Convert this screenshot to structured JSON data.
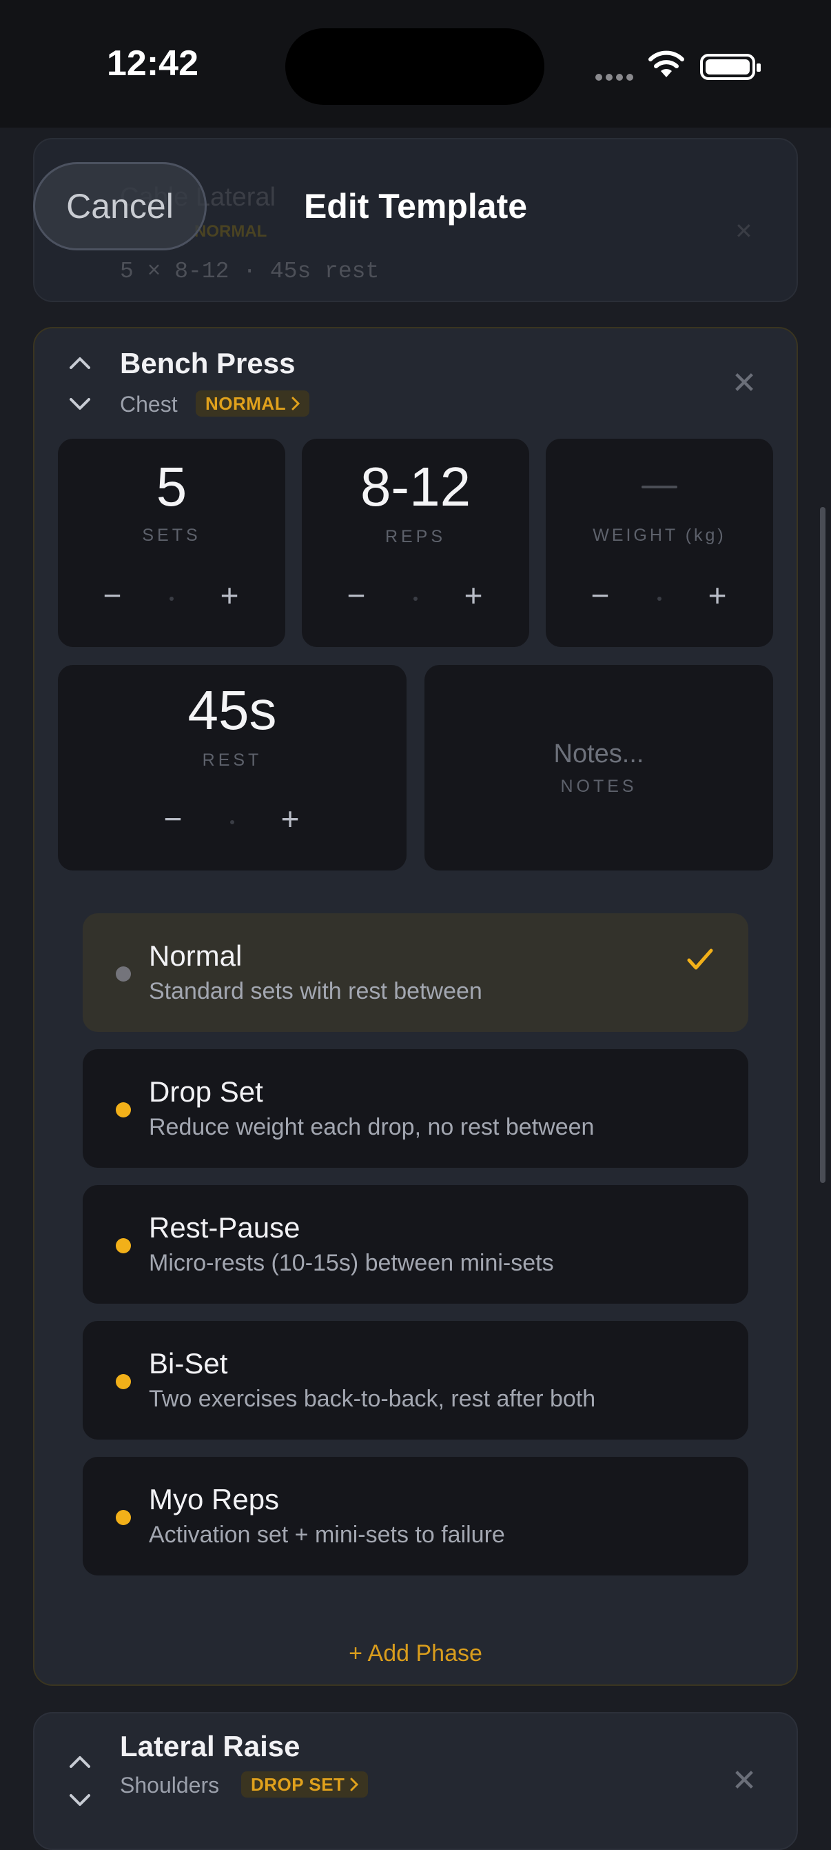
{
  "status_bar": {
    "time": "12:42"
  },
  "header": {
    "cancel_label": "Cancel",
    "title": "Edit Template"
  },
  "previous_card": {
    "title": "Cable Lateral",
    "tag": "NORMAL",
    "summary": "5 × 8-12 · 45s rest"
  },
  "exercise": {
    "name": "Bench Press",
    "muscle": "Chest",
    "set_type_tag": "NORMAL",
    "sets": {
      "value": "5",
      "label": "SETS"
    },
    "reps": {
      "value": "8-12",
      "label": "REPS"
    },
    "weight": {
      "value": "",
      "label": "WEIGHT (kg)"
    },
    "rest": {
      "value": "45s",
      "label": "REST"
    },
    "notes": {
      "placeholder": "Notes...",
      "label": "NOTES"
    },
    "stepper_minus": "−",
    "stepper_plus": "+"
  },
  "set_types": [
    {
      "name": "Normal",
      "description": "Standard sets with rest between",
      "selected": true
    },
    {
      "name": "Drop Set",
      "description": "Reduce weight each drop, no rest between",
      "selected": false
    },
    {
      "name": "Rest-Pause",
      "description": "Micro-rests (10-15s) between mini-sets",
      "selected": false
    },
    {
      "name": "Bi-Set",
      "description": "Two exercises back-to-back, rest after both",
      "selected": false
    },
    {
      "name": "Myo Reps",
      "description": "Activation set + mini-sets to failure",
      "selected": false
    }
  ],
  "add_phase_label": "+ Add Phase",
  "next_exercise": {
    "name": "Lateral Raise",
    "muscle": "Shoulders",
    "set_type_tag": "DROP SET"
  },
  "colors": {
    "accent": "#f2b019",
    "background": "#1b1d23",
    "card": "#242831",
    "tile": "#15161b"
  }
}
